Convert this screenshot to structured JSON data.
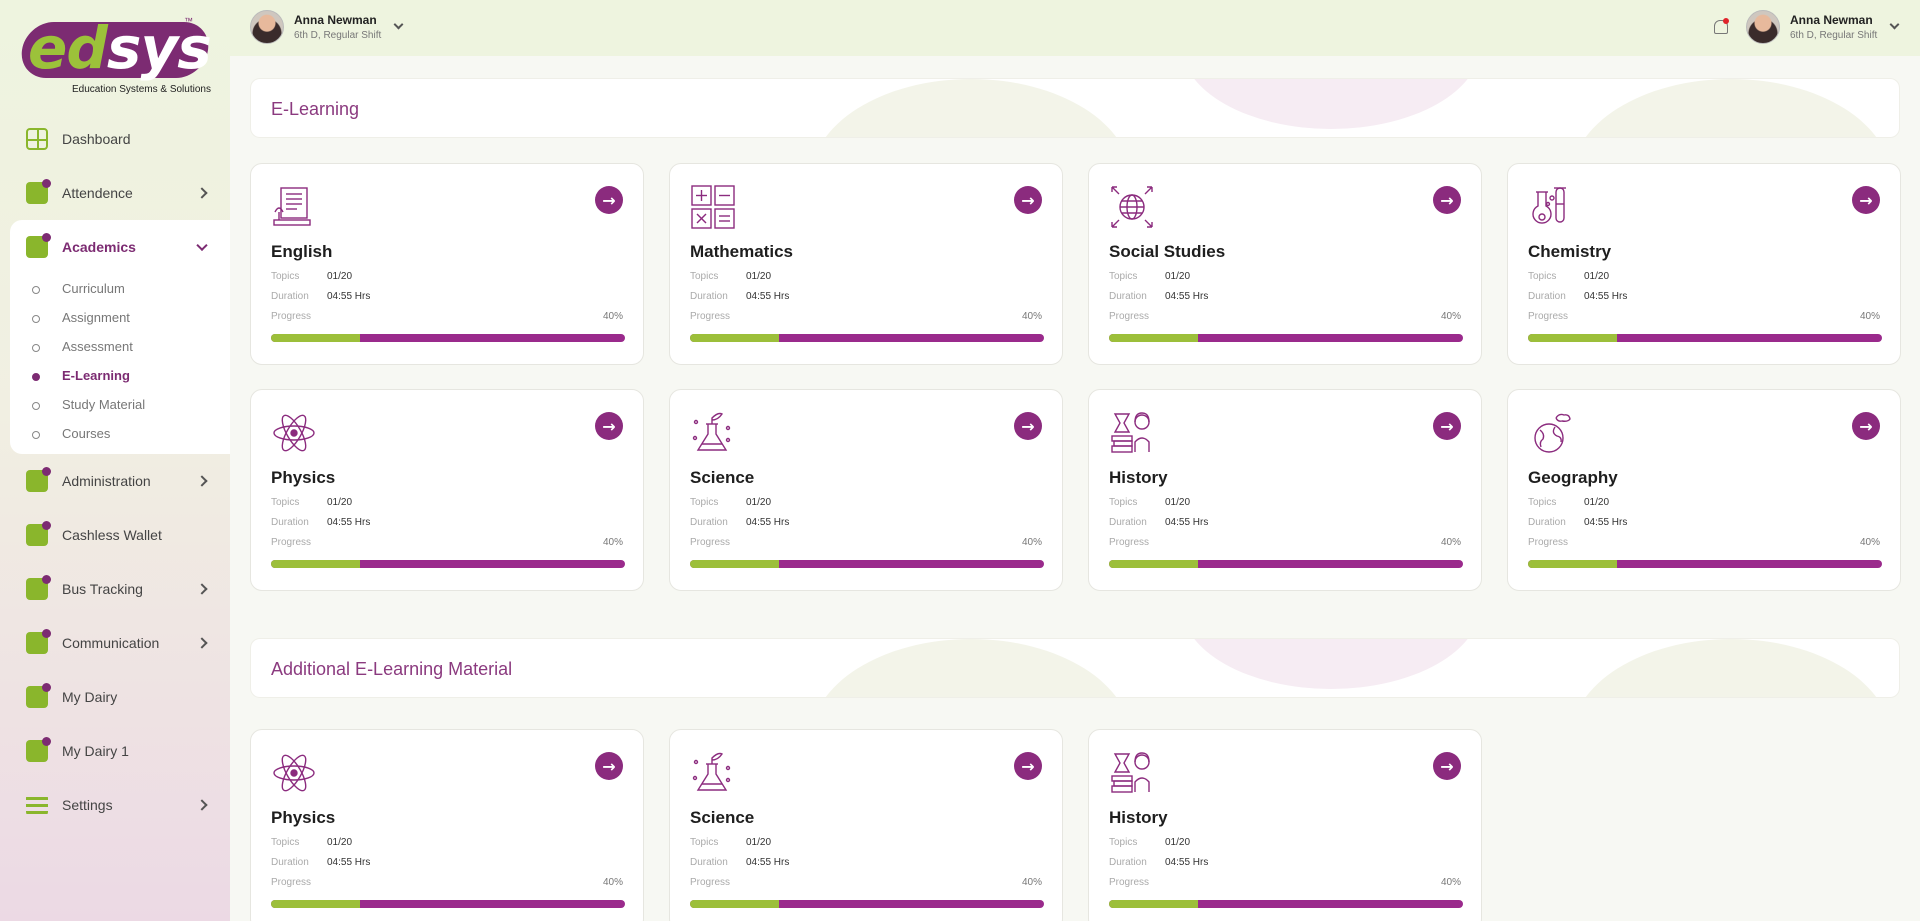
{
  "brand": {
    "logo_ed": "ed",
    "logo_sys": "sys",
    "tm": "™",
    "tagline": "Education Systems & Solutions"
  },
  "sidebar": {
    "items": [
      {
        "label": "Dashboard",
        "icon": "dashboard-icon"
      },
      {
        "label": "Attendence",
        "icon": "attendance-icon"
      },
      {
        "label": "Academics",
        "icon": "academics-icon"
      },
      {
        "label": "Administration",
        "icon": "administration-icon"
      },
      {
        "label": "Cashless Wallet",
        "icon": "wallet-icon"
      },
      {
        "label": "Bus Tracking",
        "icon": "bus-icon"
      },
      {
        "label": "Communication",
        "icon": "communication-icon"
      },
      {
        "label": "My Dairy",
        "icon": "diary-icon"
      },
      {
        "label": "My Dairy 1",
        "icon": "diary-icon"
      },
      {
        "label": "Settings",
        "icon": "settings-icon"
      }
    ],
    "academics_sub": [
      "Curriculum",
      "Assignment",
      "Assessment",
      "E-Learning",
      "Study Material",
      "Courses"
    ],
    "active_sub": "E-Learning"
  },
  "header": {
    "left_user": {
      "name": "Anna Newman",
      "role": "6th D, Regular Shift"
    },
    "right_user": {
      "name": "Anna Newman",
      "role": "6th D, Regular Shift"
    }
  },
  "labels": {
    "topics": "Topics",
    "duration": "Duration",
    "progress": "Progress"
  },
  "sections": [
    {
      "title": "E-Learning",
      "cards": [
        {
          "subject": "English",
          "icon": "book-icon",
          "topics": "01/20",
          "duration": "04:55 Hrs",
          "progress_text": "40%",
          "progress": 0.25
        },
        {
          "subject": "Mathematics",
          "icon": "math-operators-icon",
          "topics": "01/20",
          "duration": "04:55 Hrs",
          "progress_text": "40%",
          "progress": 0.25
        },
        {
          "subject": "Social Studies",
          "icon": "globe-icon",
          "topics": "01/20",
          "duration": "04:55 Hrs",
          "progress_text": "40%",
          "progress": 0.25
        },
        {
          "subject": "Chemistry",
          "icon": "flask-icon",
          "topics": "01/20",
          "duration": "04:55 Hrs",
          "progress_text": "40%",
          "progress": 0.25
        },
        {
          "subject": "Physics",
          "icon": "atom-icon",
          "topics": "01/20",
          "duration": "04:55 Hrs",
          "progress_text": "40%",
          "progress": 0.25
        },
        {
          "subject": "Science",
          "icon": "beaker-plant-icon",
          "topics": "01/20",
          "duration": "04:55 Hrs",
          "progress_text": "40%",
          "progress": 0.25
        },
        {
          "subject": "History",
          "icon": "history-icon",
          "topics": "01/20",
          "duration": "04:55 Hrs",
          "progress_text": "40%",
          "progress": 0.25
        },
        {
          "subject": "Geography",
          "icon": "earth-icon",
          "topics": "01/20",
          "duration": "04:55 Hrs",
          "progress_text": "40%",
          "progress": 0.25
        }
      ]
    },
    {
      "title": "Additional E-Learning Material",
      "cards": [
        {
          "subject": "Physics",
          "icon": "atom-icon",
          "topics": "01/20",
          "duration": "04:55 Hrs",
          "progress_text": "40%",
          "progress": 0.25
        },
        {
          "subject": "Science",
          "icon": "beaker-plant-icon",
          "topics": "01/20",
          "duration": "04:55 Hrs",
          "progress_text": "40%",
          "progress": 0.25
        },
        {
          "subject": "History",
          "icon": "history-icon",
          "topics": "01/20",
          "duration": "04:55 Hrs",
          "progress_text": "40%",
          "progress": 0.25
        }
      ]
    }
  ],
  "colors": {
    "primary": "#8b2b7e",
    "accent": "#9cbf3a",
    "title": "#8b3a7f"
  }
}
